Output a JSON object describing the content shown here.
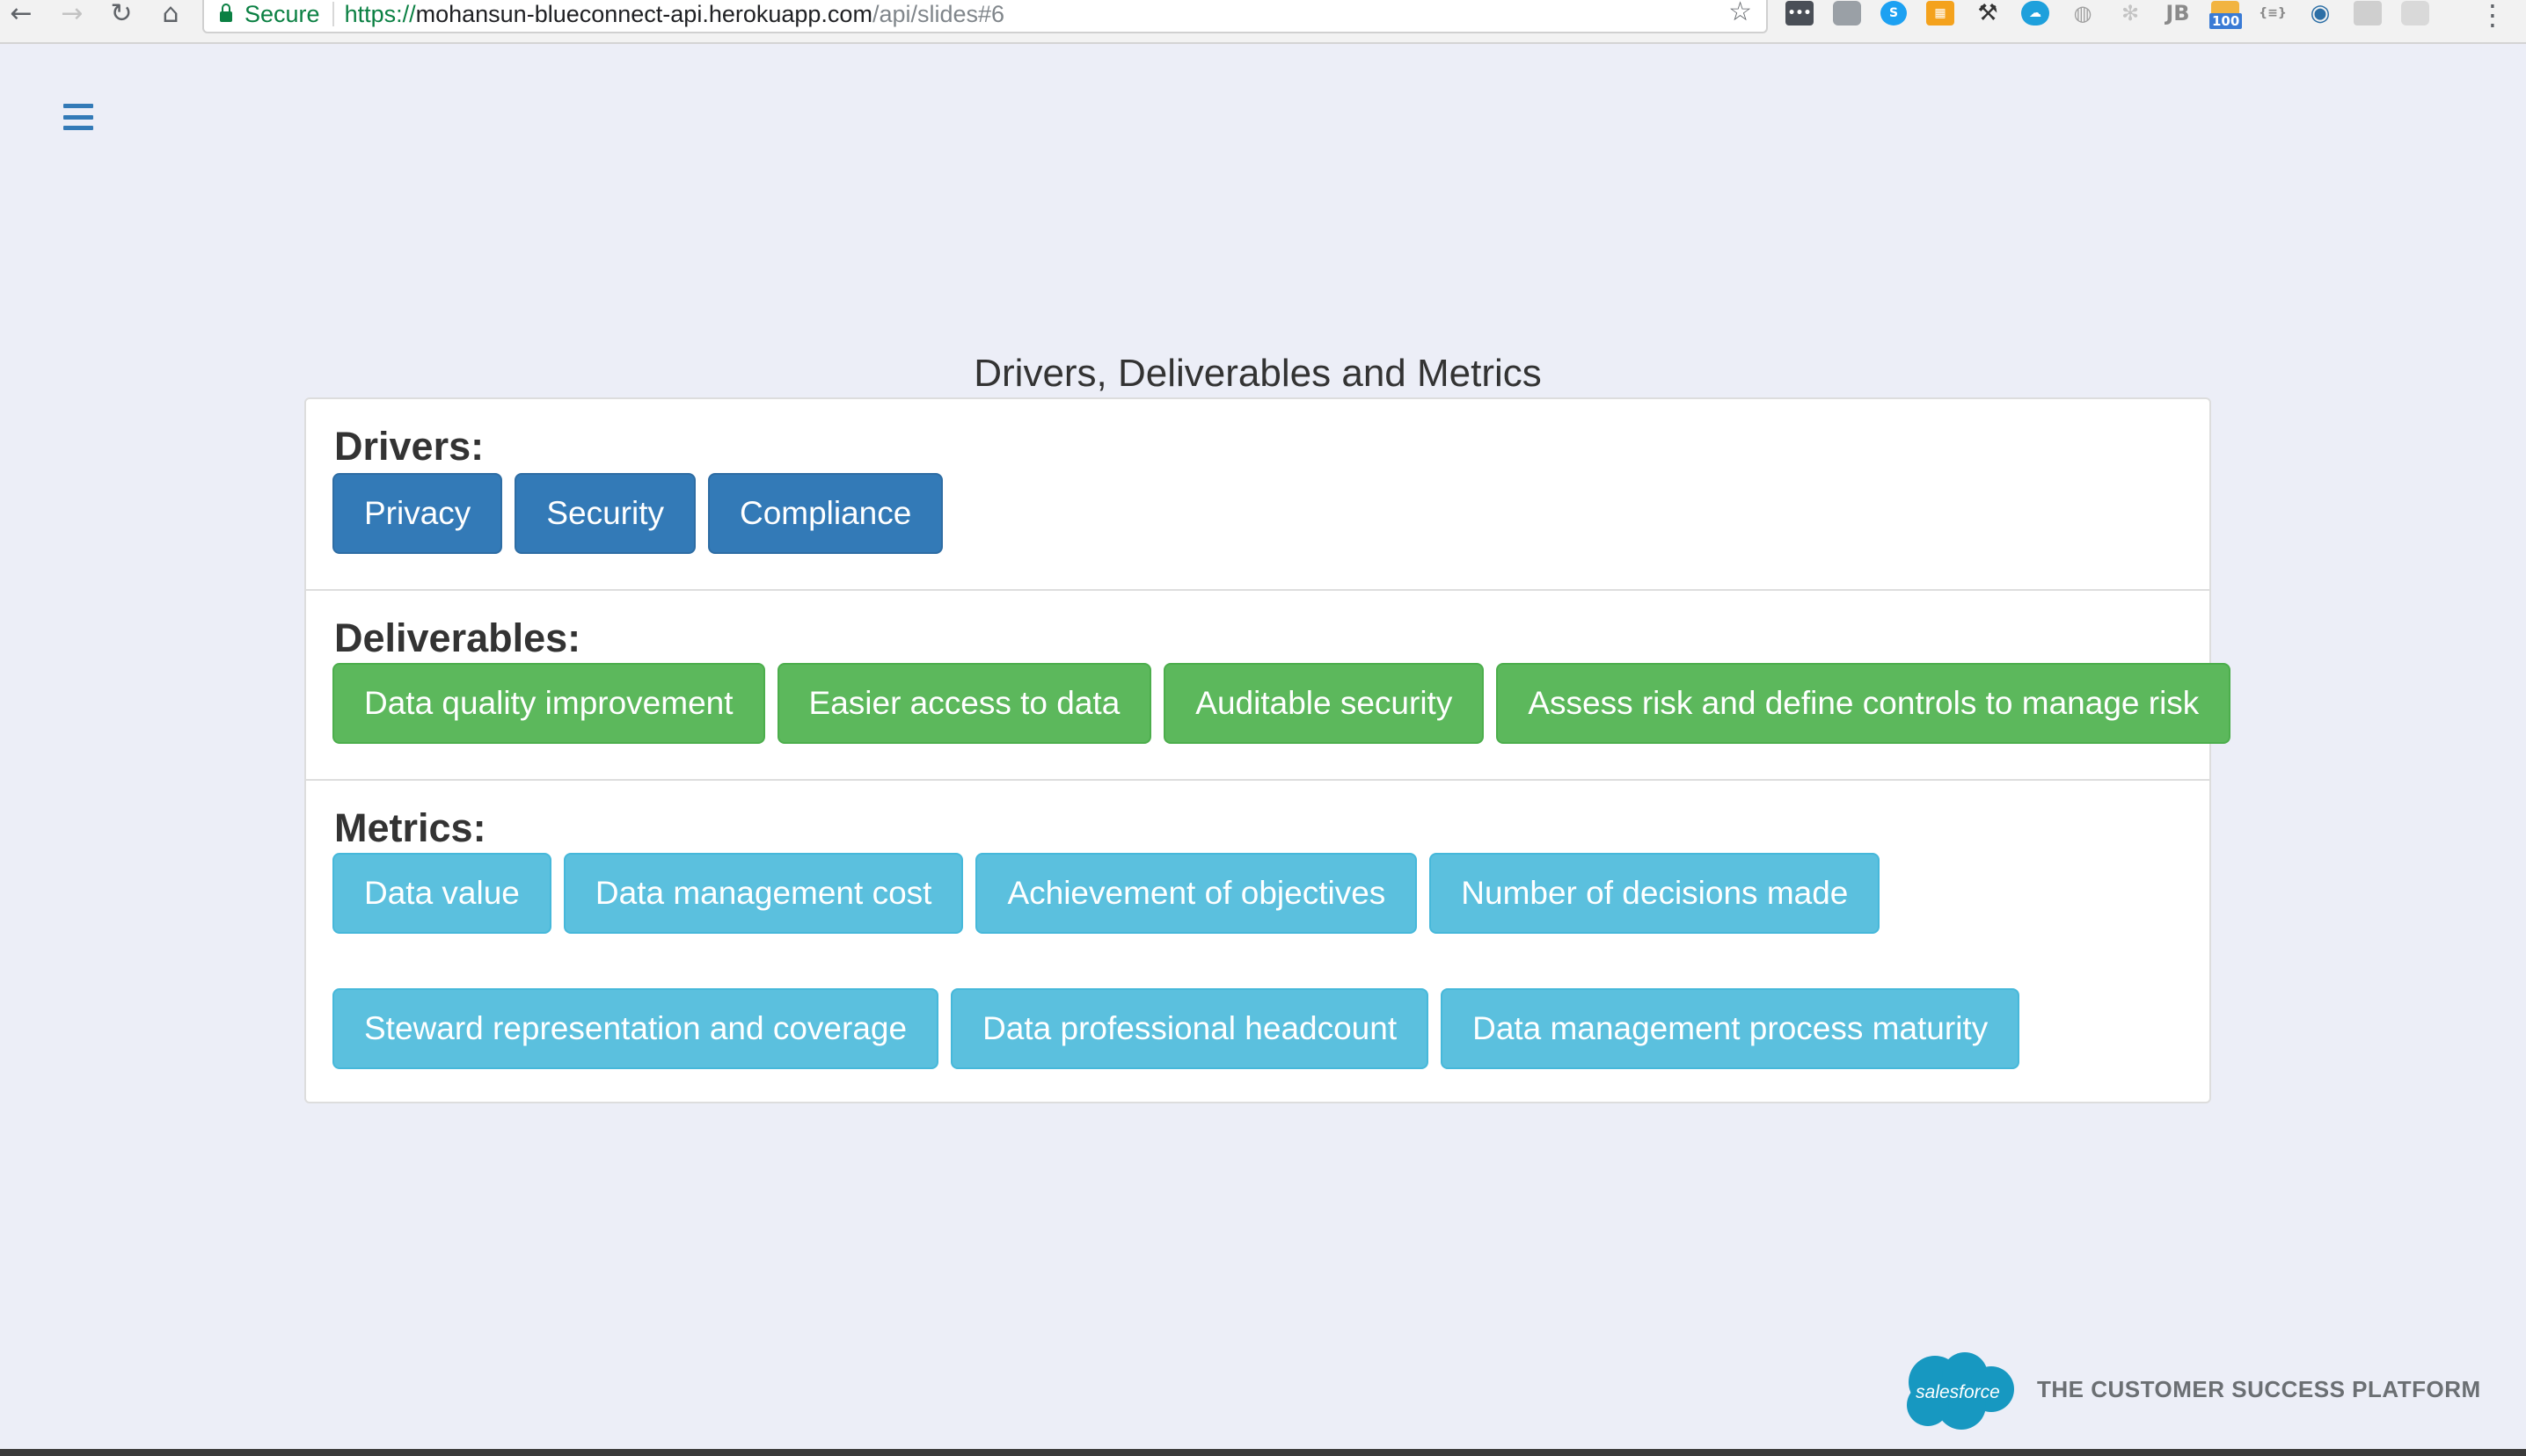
{
  "browser": {
    "secure_label": "Secure",
    "url_scheme": "https://",
    "url_host": "mohansun-blueconnect-api.herokuapp.com",
    "url_path": "/api/slides#6",
    "extension_badge": "100",
    "extension_json": "{≡}"
  },
  "page": {
    "title": "Drivers, Deliverables and Metrics"
  },
  "sections": {
    "drivers": {
      "heading": "Drivers:",
      "items": [
        "Privacy",
        "Security",
        "Compliance"
      ]
    },
    "deliverables": {
      "heading": "Deliverables:",
      "items": [
        "Data quality improvement",
        "Easier access to data",
        "Auditable security",
        "Assess risk and define controls to manage risk"
      ]
    },
    "metrics": {
      "heading": "Metrics:",
      "items": [
        "Data value",
        "Data management cost",
        "Achievement of objectives",
        "Number of decisions made",
        "Steward representation and coverage",
        "Data professional headcount",
        "Data management process maturity"
      ]
    }
  },
  "footer": {
    "logo_text": "salesforce",
    "tagline": "THE CUSTOMER SUCCESS PLATFORM"
  },
  "colors": {
    "drivers_button": "#337ab7",
    "deliverables_button": "#5cb85c",
    "metrics_button": "#5bc0de",
    "hamburger": "#337ab7",
    "salesforce_blue": "#1798c1",
    "page_background": "#eceef7"
  }
}
